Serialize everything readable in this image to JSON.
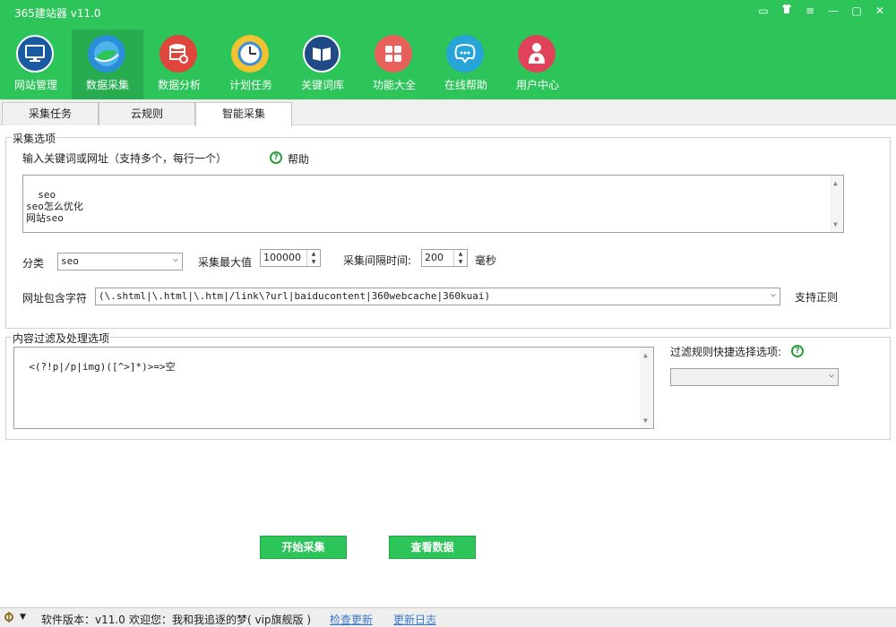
{
  "app": {
    "title": "365建站器 v11.0"
  },
  "window_controls": [
    {
      "icon": "message-icon",
      "glyph": "▭"
    },
    {
      "icon": "skin-icon",
      "glyph": "👕"
    },
    {
      "icon": "menu-icon",
      "glyph": "≡"
    },
    {
      "icon": "minimize-icon",
      "glyph": "—"
    },
    {
      "icon": "maximize-icon",
      "glyph": "▢"
    },
    {
      "icon": "close-icon",
      "glyph": "✕"
    }
  ],
  "nav": [
    {
      "label": "网站管理",
      "icon": "monitor-icon",
      "color": "#1a5aa0",
      "active": false
    },
    {
      "label": "数据采集",
      "icon": "globe-icon",
      "color": "#2a8fd8",
      "active": true
    },
    {
      "label": "数据分析",
      "icon": "database-icon",
      "color": "#e0463c",
      "active": false
    },
    {
      "label": "计划任务",
      "icon": "clock-icon",
      "color": "#f2c230",
      "active": false
    },
    {
      "label": "关键词库",
      "icon": "book-icon",
      "color": "#1f4a86",
      "active": false
    },
    {
      "label": "功能大全",
      "icon": "grid-icon",
      "color": "#e8605a",
      "active": false
    },
    {
      "label": "在线帮助",
      "icon": "chat-icon",
      "color": "#26a4d8",
      "active": false
    },
    {
      "label": "用户中心",
      "icon": "user-icon",
      "color": "#e0425a",
      "active": false
    }
  ],
  "tabs": [
    {
      "label": "采集任务"
    },
    {
      "label": "云规则"
    },
    {
      "label": "智能采集"
    }
  ],
  "collect_options": {
    "group_title": "采集选项",
    "keyword_label": "输入关键词或网址（支持多个，每行一个）",
    "help_label": "帮助",
    "keywords": "seo\nseo怎么优化\n网站seo",
    "category_label": "分类",
    "category_value": "seo",
    "max_label": "采集最大值",
    "max_value": "100000",
    "interval_label": "采集间隔时间:",
    "interval_value": "200",
    "interval_unit": "毫秒",
    "url_contains_label": "网址包含字符",
    "url_contains_value": "(\\.shtml|\\.html|\\.htm|/link\\?url|baiducontent|360webcache|360kuai)",
    "regex_label": "支持正则"
  },
  "filter_options": {
    "group_title": "内容过滤及处理选项",
    "rules": "<(?!p|/p|img)([^>]*)>=>空",
    "quick_select_label": "过滤规则快捷选择选项:",
    "quick_select_value": ""
  },
  "buttons": {
    "start": "开始采集",
    "view": "查看数据"
  },
  "status": {
    "version_label": "软件版本：v11.0",
    "welcome_label": "欢迎您：我和我追逐的梦( vip旗舰版 )",
    "check_update": "检查更新",
    "update_log": "更新日志"
  }
}
